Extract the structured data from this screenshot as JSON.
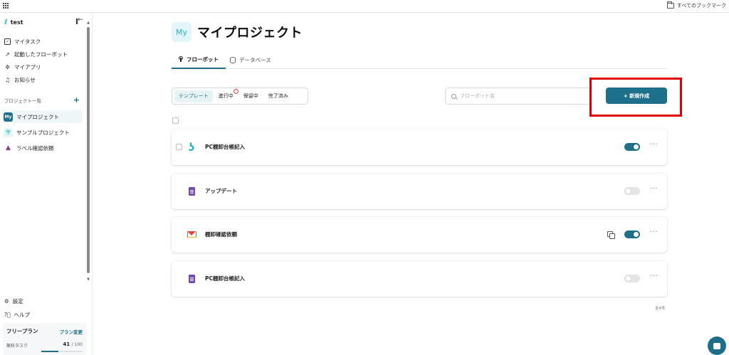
{
  "bookmark_bar": {
    "all_bookmarks_label": "すべてのブックマーク"
  },
  "sidebar": {
    "workspace_name": "test",
    "nav": [
      {
        "label": "マイタスク",
        "icon": "checkbox-icon"
      },
      {
        "label": "起動したフローボット",
        "icon": "trend-icon"
      },
      {
        "label": "マイアプリ",
        "icon": "apps-icon"
      },
      {
        "label": "お知らせ",
        "icon": "bell-icon"
      }
    ],
    "projects_heading": "プロジェクト一覧",
    "projects": [
      {
        "badge": "My",
        "label": "マイプロジェクト",
        "active": true
      },
      {
        "badge": "サ",
        "label": "サンプルプロジェクト",
        "active": false
      },
      {
        "badge": "▲",
        "label": "ラベル確認依頼",
        "active": false
      }
    ],
    "settings_label": "設定",
    "help_label": "ヘルプ",
    "plan": {
      "name": "フリープラン",
      "change_label": "プラン変更",
      "task_label": "無料タスク",
      "used": "41",
      "total": "/ 100",
      "usage_fraction": 0.41
    }
  },
  "main": {
    "page_badge": "My",
    "title": "マイプロジェクト",
    "tabs": [
      {
        "label": "フローボット",
        "active": true
      },
      {
        "label": "データベース",
        "active": false
      }
    ],
    "filters": [
      {
        "label": "テンプレート",
        "active": true
      },
      {
        "label": "進行中",
        "active": false,
        "badge": "!"
      },
      {
        "label": "保留中",
        "active": false
      },
      {
        "label": "完了済み",
        "active": false
      }
    ],
    "search": {
      "placeholder": "フローボット名",
      "value": ""
    },
    "new_button_label": "+ 新規作成",
    "flows": [
      {
        "name": "PC棚卸台帳記入",
        "app_icon": "yoom-icon",
        "enabled": true,
        "show_copy": false
      },
      {
        "name": "アップデート",
        "app_icon": "google-forms-icon",
        "enabled": false,
        "show_copy": false
      },
      {
        "name": "棚卸確認依頼",
        "app_icon": "gmail-icon",
        "enabled": true,
        "show_copy": true
      },
      {
        "name": "PC棚卸台帳記入",
        "app_icon": "google-forms-icon",
        "enabled": false,
        "show_copy": false
      }
    ],
    "total_count": "全4件"
  },
  "colors": {
    "accent": "#1e6f89",
    "brand_light": "#27b5c9",
    "highlight": "#e00000"
  }
}
